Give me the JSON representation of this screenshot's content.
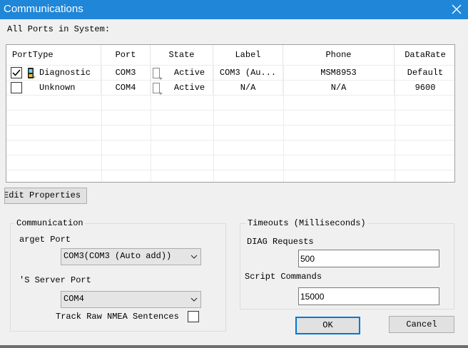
{
  "window": {
    "title": "Communications"
  },
  "ports_label": "All Ports in System:",
  "table": {
    "columns": [
      "PortType",
      "Port",
      "State",
      "Label",
      "Phone",
      "DataRate"
    ],
    "rows": [
      {
        "checked": true,
        "port_type": "Diagnostic",
        "port": "COM3",
        "state": "Active",
        "label": "COM3 (Au...",
        "phone": "MSM8953",
        "data_rate": "Default"
      },
      {
        "checked": false,
        "port_type": "Unknown",
        "port": "COM4",
        "state": "Active",
        "label": "N/A",
        "phone": "N/A",
        "data_rate": "9600"
      }
    ]
  },
  "edit_properties_label": "Edit Properties",
  "communication": {
    "legend": "Communication",
    "target_port_label": "arget Port",
    "target_port_value": "COM3(COM3 (Auto add))",
    "server_port_label": "'S Server Port",
    "server_port_value": "COM4",
    "track_nmea_label": "Track Raw NMEA Sentences",
    "track_nmea_checked": false
  },
  "timeouts": {
    "legend": "Timeouts (Milliseconds)",
    "diag_label": "DIAG Requests",
    "diag_value": "500",
    "script_label": "Script Commands",
    "script_value": "15000"
  },
  "buttons": {
    "ok": "OK",
    "cancel": "Cancel"
  },
  "colors": {
    "titlebar": "#1f86d8",
    "accent": "#0078d7"
  }
}
